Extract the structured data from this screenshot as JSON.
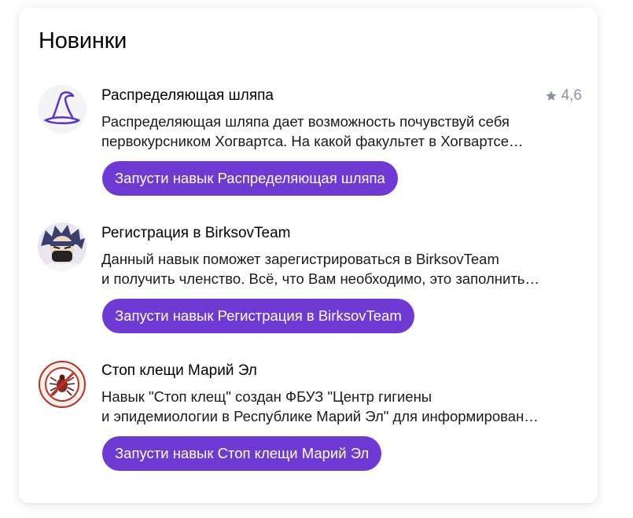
{
  "section": {
    "title": "Новинки"
  },
  "colors": {
    "accent": "#6e3ad3",
    "rating": "#8a93a3"
  },
  "skills": [
    {
      "name": "Распределяющая шляпа",
      "rating": "4,6",
      "icon": "wizard-hat-icon",
      "desc_line1": "Распределяющая шляпа дает возможность почувствуй себя",
      "desc_line2": "первокурсником Хогвартса. На какой факультет в Хогвартсе…",
      "button_label": "Запусти навык Распределяющая шляпа"
    },
    {
      "name": "Регистрация в BirksovTeam",
      "icon": "anime-character-avatar",
      "desc_line1": "Данный навык поможет зарегистрироваться в BirksovTeam",
      "desc_line2": "и получить членство. Всё, что Вам необходимо, это заполнить…",
      "button_label": "Запусти навык Регистрация в BirksovTeam"
    },
    {
      "name": "Стоп клещи Марий Эл",
      "icon": "tick-stop-emblem",
      "desc_line1": "Навык \"Стоп клещ\" создан ФБУЗ \"Центр гигиены",
      "desc_line2": "и эпидемиологии в Республике Марий Эл\" для информирован…",
      "button_label": "Запусти навык Стоп клещи Марий Эл"
    }
  ]
}
